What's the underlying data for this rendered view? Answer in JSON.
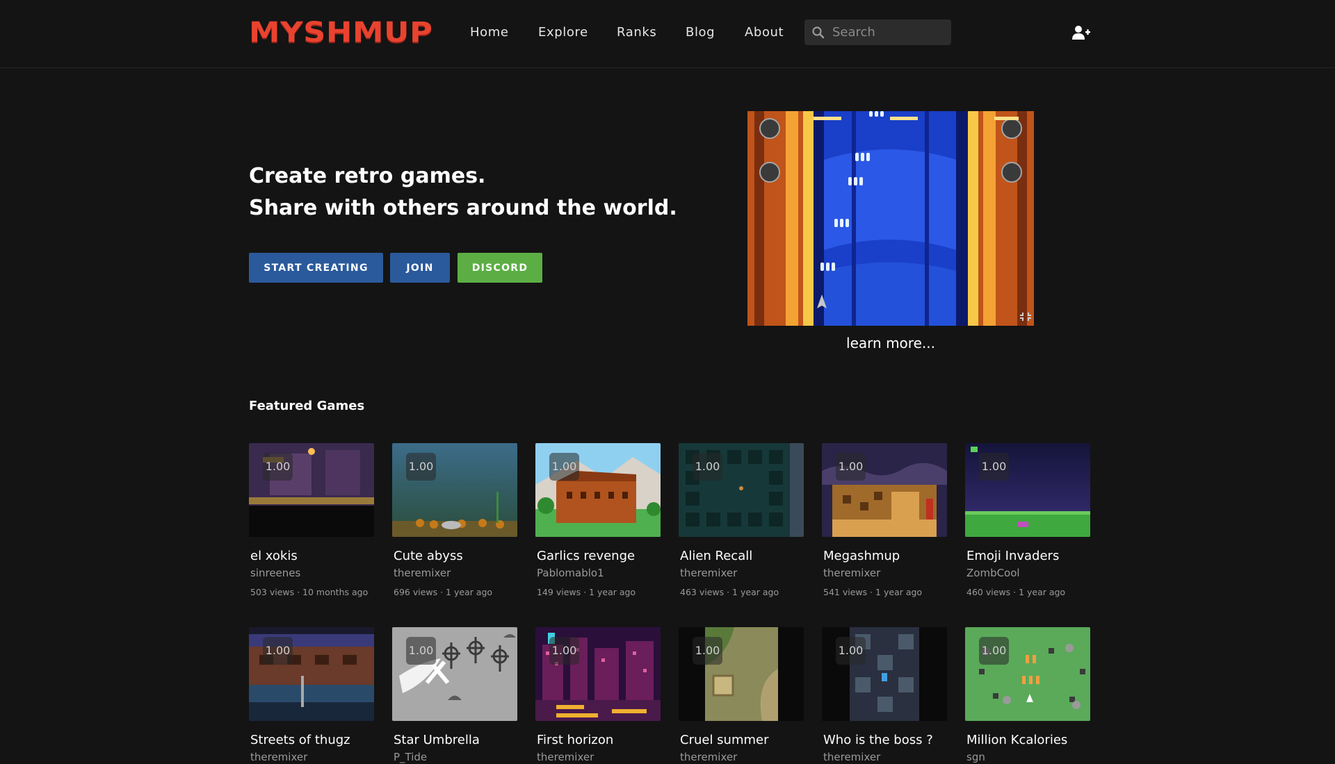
{
  "header": {
    "logo": "MYSHMUP",
    "nav": [
      "Home",
      "Explore",
      "Ranks",
      "Blog",
      "About"
    ],
    "search_placeholder": "Search",
    "icons": {
      "search": "search-icon",
      "account": "add-user-icon"
    }
  },
  "hero": {
    "line1": "Create retro games.",
    "line2": "Share with others around the world.",
    "buttons": {
      "start": "START CREATING",
      "join": "JOIN",
      "discord": "DISCORD"
    },
    "learn_more": "learn more..."
  },
  "featured": {
    "title": "Featured Games",
    "games": [
      {
        "title": "el xokis",
        "author": "sinreenes",
        "meta": "503 views · 10 months ago",
        "rating": "1.00"
      },
      {
        "title": "Cute abyss",
        "author": "theremixer",
        "meta": "696 views · 1 year ago",
        "rating": "1.00"
      },
      {
        "title": "Garlics revenge",
        "author": "Pablomablo1",
        "meta": "149 views · 1 year ago",
        "rating": "1.00"
      },
      {
        "title": "Alien Recall",
        "author": "theremixer",
        "meta": "463 views · 1 year ago",
        "rating": "1.00"
      },
      {
        "title": "Megashmup",
        "author": "theremixer",
        "meta": "541 views · 1 year ago",
        "rating": "1.00"
      },
      {
        "title": "Emoji Invaders",
        "author": "ZombCool",
        "meta": "460 views · 1 year ago",
        "rating": "1.00"
      },
      {
        "title": "Streets of thugz",
        "author": "theremixer",
        "rating": "1.00"
      },
      {
        "title": "Star Umbrella",
        "author": "P_Tide",
        "rating": "1.00"
      },
      {
        "title": "First horizon",
        "author": "theremixer",
        "rating": "1.00"
      },
      {
        "title": "Cruel summer",
        "author": "theremixer",
        "rating": "1.00"
      },
      {
        "title": "Who is the boss ?",
        "author": "theremixer",
        "rating": "1.00"
      },
      {
        "title": "Million Kcalories",
        "author": "sgn",
        "rating": "1.00"
      }
    ]
  },
  "colors": {
    "background": "#141414",
    "logo": "#e8432f",
    "button_blue": "#2a5a9b",
    "button_green": "#5cae44"
  }
}
